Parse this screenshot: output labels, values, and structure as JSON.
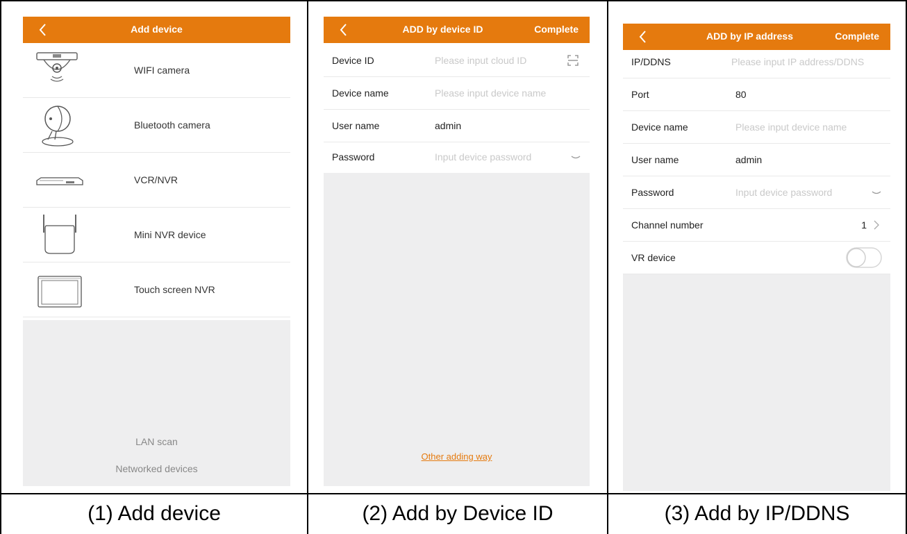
{
  "panel1": {
    "back_icon": "chevron-left-icon",
    "title": "Add device",
    "devices": [
      {
        "label": "WIFI camera",
        "icon": "wifi-camera-icon"
      },
      {
        "label": "Bluetooth camera",
        "icon": "bluetooth-camera-icon"
      },
      {
        "label": "VCR/NVR",
        "icon": "nvr-box-icon"
      },
      {
        "label": "Mini NVR device",
        "icon": "mini-nvr-icon"
      },
      {
        "label": "Touch screen NVR",
        "icon": "touch-screen-icon"
      }
    ],
    "lan_scan": "LAN scan",
    "networked": "Networked devices"
  },
  "panel2": {
    "title": "ADD by device ID",
    "complete": "Complete",
    "fields": [
      {
        "label": "Device ID",
        "value": "Please input cloud ID",
        "placeholder": true,
        "icon": "scan-icon"
      },
      {
        "label": "Device name",
        "value": "Please input device name",
        "placeholder": true
      },
      {
        "label": "User name",
        "value": "admin",
        "placeholder": false
      },
      {
        "label": "Password",
        "value": "Input device password",
        "placeholder": true,
        "icon": "eye-closed-icon"
      }
    ],
    "other_way": "Other adding way"
  },
  "panel3": {
    "title": "ADD by IP address",
    "complete": "Complete",
    "fields": [
      {
        "label": "IP/DDNS",
        "value": "Please input IP address/DDNS",
        "placeholder": true
      },
      {
        "label": "Port",
        "value": "80",
        "placeholder": false
      },
      {
        "label": "Device name",
        "value": "Please input device name",
        "placeholder": true
      },
      {
        "label": "User name",
        "value": "admin",
        "placeholder": false
      },
      {
        "label": "Password",
        "value": "Input device password",
        "placeholder": true,
        "icon": "eye-closed-icon"
      },
      {
        "label": "Channel number",
        "value": "1",
        "placeholder": false,
        "icon": "chevron-right-icon"
      },
      {
        "label": "VR device",
        "value": "",
        "placeholder": false,
        "icon": "toggle-off-icon"
      }
    ]
  },
  "captions": [
    "(1) Add device",
    "(2) Add by Device ID",
    "(3) Add by IP/DDNS"
  ],
  "colors": {
    "accent": "#e57a0e",
    "background_gray": "#eeeeef",
    "placeholder": "#c9c9c9"
  }
}
